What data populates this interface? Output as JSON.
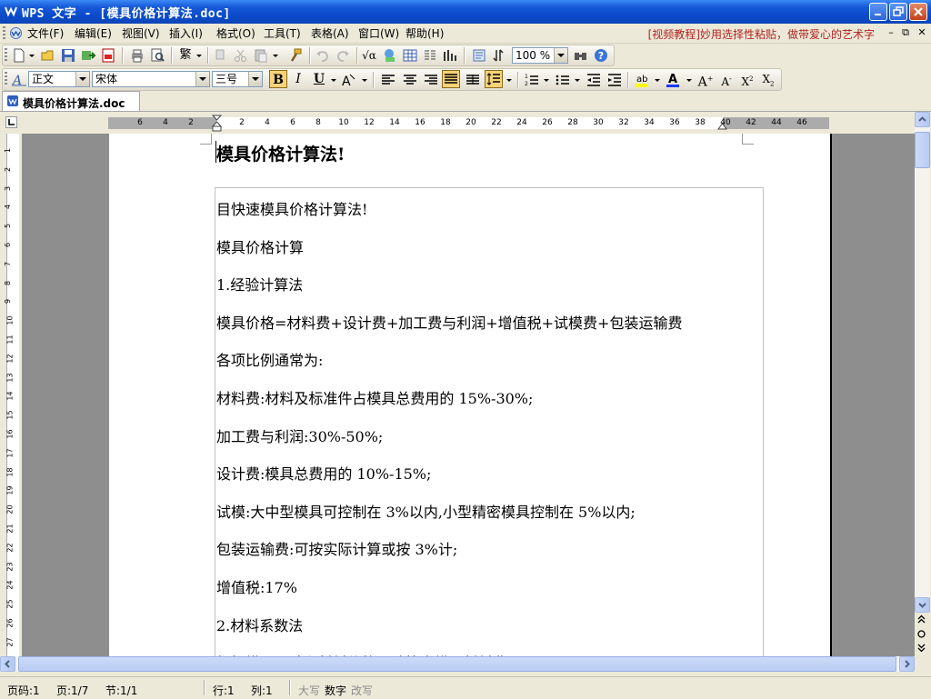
{
  "window": {
    "title": "WPS 文字 - [模具价格计算法.doc]",
    "accent": "#0a49c9"
  },
  "menu": {
    "items": [
      {
        "label": "文件(F)"
      },
      {
        "label": "编辑(E)"
      },
      {
        "label": "视图(V)"
      },
      {
        "label": "插入(I)"
      },
      {
        "label": "格式(O)"
      },
      {
        "label": "工具(T)"
      },
      {
        "label": "表格(A)"
      },
      {
        "label": "窗口(W)"
      },
      {
        "label": "帮助(H)"
      }
    ],
    "promo": "[视频教程]妙用选择性粘贴，做带爱心的艺术字"
  },
  "toolbar": {
    "zoom": "100 %",
    "style": "正文",
    "font": "宋体",
    "size": "三号",
    "bold_label": "B",
    "italic_label": "I",
    "underline_label": "U"
  },
  "tab": {
    "label": "模具价格计算法.doc"
  },
  "ruler": {
    "h_numbers": [
      "6",
      "4",
      "2",
      "2",
      "4",
      "6",
      "8",
      "10",
      "12",
      "14",
      "16",
      "18",
      "20",
      "22",
      "24",
      "26",
      "28",
      "30",
      "32",
      "34",
      "36",
      "38",
      "40",
      "42",
      "44",
      "46"
    ],
    "v_numbers": [
      "1",
      "2",
      "3",
      "4",
      "5",
      "6",
      "7",
      "8",
      "9",
      "10",
      "11",
      "12",
      "13",
      "14",
      "15",
      "16",
      "17",
      "18",
      "19",
      "20",
      "21",
      "22",
      "23",
      "24",
      "25",
      "26",
      "27"
    ]
  },
  "document": {
    "title": "模具价格计算法!",
    "paragraphs": [
      "目快速模具价格计算法!",
      "模具价格计算",
      "1.经验计算法",
      "模具价格=材料费+设计费+加工费与利润+增值税+试模费+包装运输费",
      "各项比例通常为:",
      "材料费:材料及标准件占模具总费用的 15%-30%;",
      "加工费与利润:30%-50%;",
      "设计费:模具总费用的 10%-15%;",
      "试模:大中型模具可控制在 3%以内,小型精密模具控制在 5%以内;",
      "包装运输费:可按实际计算或按 3%计;",
      "增值税:17%",
      "2.材料系数法",
      "根据模具尺寸和材料价格可计算出模具材料费"
    ]
  },
  "status": {
    "page_code": "页码:1",
    "page": "页:1/7",
    "section": "节:1/1",
    "row": "行:1",
    "col": "列:1",
    "caps": "大写",
    "num": "数字",
    "ovr": "改写"
  }
}
